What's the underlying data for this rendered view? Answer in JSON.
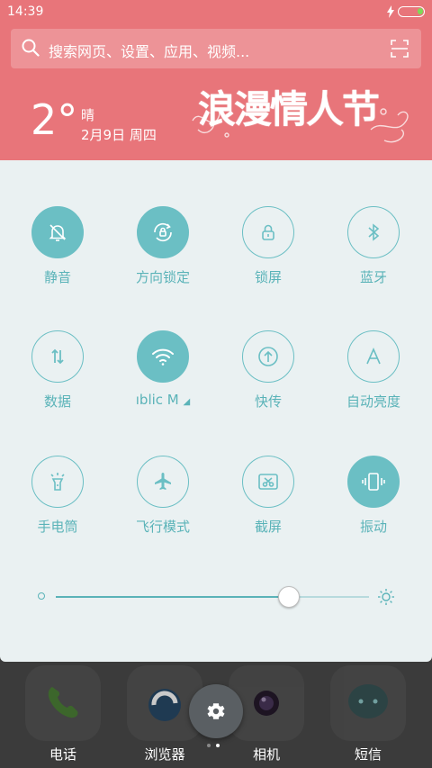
{
  "status": {
    "time": "14:39"
  },
  "search": {
    "placeholder": "搜索网页、设置、应用、视频..."
  },
  "weather": {
    "temp": "2°",
    "condition": "晴",
    "date": "2月9日 周四"
  },
  "banner": {
    "text": "浪漫情人节"
  },
  "toggles": [
    {
      "label": "静音",
      "icon": "bell-off-icon",
      "on": true
    },
    {
      "label": "方向锁定",
      "icon": "rotation-lock-icon",
      "on": true
    },
    {
      "label": "锁屏",
      "icon": "lock-icon",
      "on": false
    },
    {
      "label": "蓝牙",
      "icon": "bluetooth-icon",
      "on": false
    },
    {
      "label": "数据",
      "icon": "data-arrows-icon",
      "on": false
    },
    {
      "label": "ıblic   M",
      "icon": "wifi-icon",
      "on": true
    },
    {
      "label": "快传",
      "icon": "upload-icon",
      "on": false
    },
    {
      "label": "自动亮度",
      "icon": "auto-brightness-icon",
      "on": false
    },
    {
      "label": "手电筒",
      "icon": "flashlight-icon",
      "on": false
    },
    {
      "label": "飞行模式",
      "icon": "airplane-icon",
      "on": false
    },
    {
      "label": "截屏",
      "icon": "screenshot-icon",
      "on": false
    },
    {
      "label": "振动",
      "icon": "vibrate-icon",
      "on": true
    }
  ],
  "brightness": {
    "level": 0.74
  },
  "dock": {
    "apps": [
      {
        "label": "电话"
      },
      {
        "label": "浏览器"
      },
      {
        "label": "相机"
      },
      {
        "label": "短信"
      }
    ]
  },
  "colors": {
    "accent": "#6bbfc4",
    "header": "#e8757a",
    "panel": "#eaf1f2"
  }
}
